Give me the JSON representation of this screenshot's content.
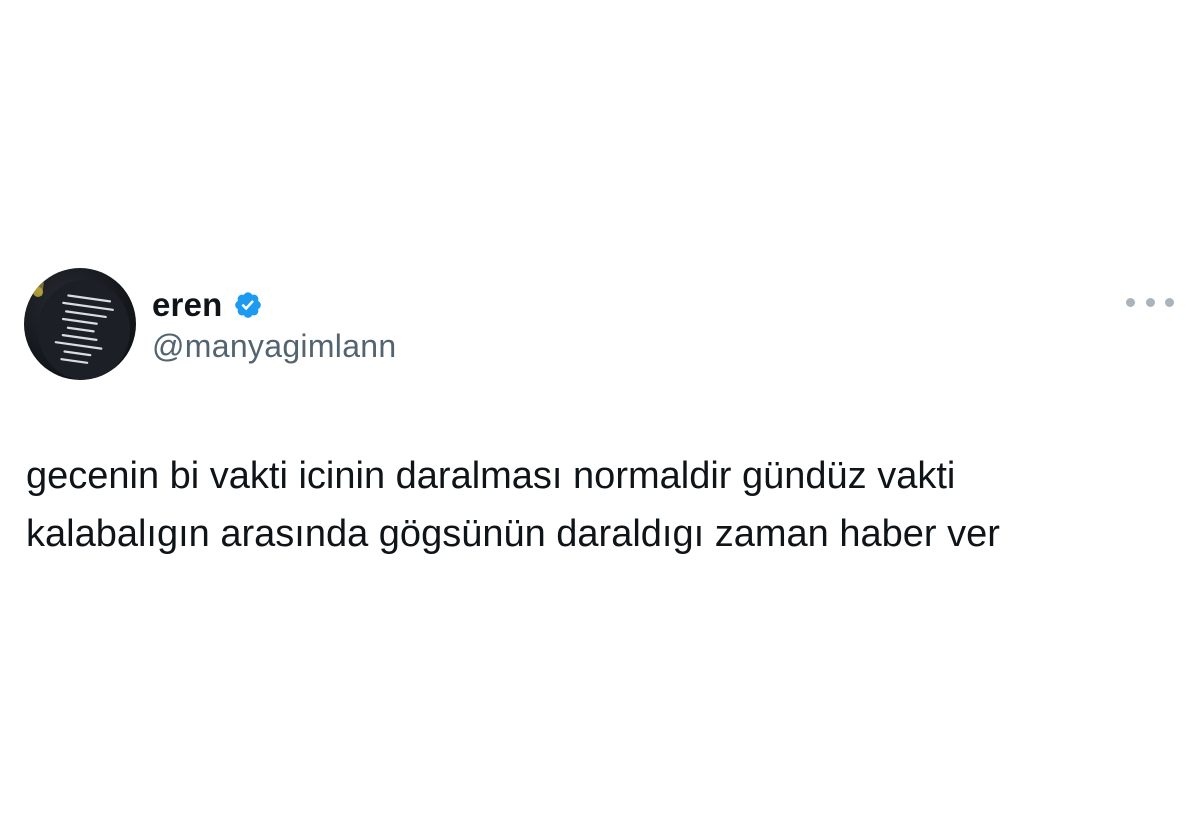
{
  "author": {
    "display_name": "eren",
    "handle": "@manyagimlann",
    "verified": true,
    "verified_color": "#1d9bf0"
  },
  "tweet": {
    "lines": [
      "gecenin bi vakti icinin daralması normaldir gündüz vakti",
      "kalabalıgın arasında gögsünün daraldıgı zaman haber ver"
    ]
  },
  "icons": {
    "verified": "verified-badge-icon",
    "more": "more-options-icon"
  },
  "colors": {
    "text": "#0f1419",
    "secondary": "#536471",
    "more_dots": "#a9b4bd"
  }
}
